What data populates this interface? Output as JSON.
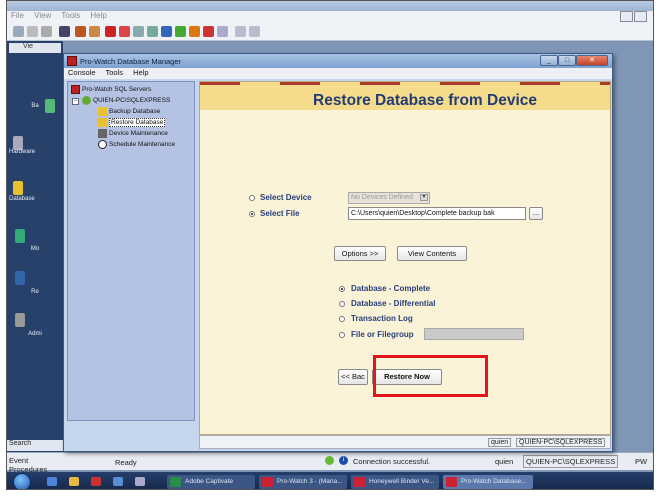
{
  "background_app": {
    "menu": [
      "File",
      "View",
      "Tools",
      "Help"
    ],
    "nav_header": "Vie",
    "nav_items": [
      "Ba",
      "Hardware",
      "Database",
      "Mo",
      "Re",
      "Admi"
    ],
    "search_label": "Search",
    "event_procedures": "Event Procedures",
    "status_ready": "Ready",
    "status_connection": "Connection successful.",
    "status_user": "quien",
    "status_server": "QUIEN-PC\\SQLEXPRESS",
    "status_extra": "PW"
  },
  "taskbar": {
    "items": [
      "Adobe Captivate",
      "Pro-Watch 3 - (Mana...",
      "Honeywell Binder Ve...",
      "Pro-Watch Database..."
    ]
  },
  "dialog": {
    "title": "Pro-Watch Database Manager",
    "menu": [
      "Console",
      "Tools",
      "Help"
    ],
    "tree": {
      "root": "Pro-Watch SQL Servers",
      "server": "QUIEN-PC\\SQLEXPRESS",
      "children": [
        "Backup Database",
        "Restore Database",
        "Device Maintenance",
        "Schedule Maintenance"
      ]
    },
    "pane": {
      "title": "Restore Database from Device",
      "select_device_label": "Select Device",
      "select_file_label": "Select File",
      "device_combo_value": "No Devices Defined",
      "file_path_value": "C:\\Users\\quien\\Desktop\\Complete backup bak",
      "browse_label": "...",
      "options_button": "Options >>",
      "view_contents_button": "View Contents",
      "restore_types": [
        "Database - Complete",
        "Database - Differential",
        "Transaction Log",
        "File or Filegroup"
      ],
      "back_button": "<< Bac",
      "restore_now_button": "Restore Now"
    },
    "status": {
      "user": "quien",
      "server": "QUIEN-PC\\SQLEXPRESS"
    }
  },
  "colors": {
    "highlight": "#e5141b",
    "pane_title": "#243c74",
    "label": "#263e7a"
  }
}
